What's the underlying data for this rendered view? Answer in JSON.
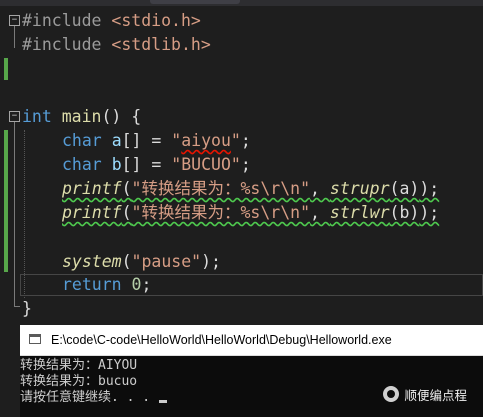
{
  "editor": {
    "lines": {
      "l1": {
        "pre": "#include",
        "arg": "<stdio.h>"
      },
      "l2": {
        "pre": "#include",
        "arg": "<stdlib.h>"
      },
      "l3": {
        "kw": "int",
        "fn": "main",
        "rest": "() {"
      },
      "l4": {
        "kw": "char",
        "var": "a",
        "mid": "[] = ",
        "q1": "\"",
        "str": "aiyou",
        "q2": "\"",
        "end": ";"
      },
      "l5": {
        "kw": "char",
        "var": "b",
        "mid": "[] = ",
        "str": "\"BUCUO\"",
        "end": ";"
      },
      "l6": {
        "fn": "printf",
        "open": "(",
        "str": "\"转换结果为：%s\\r\\n\"",
        "comma": ", ",
        "fn2": "strupr",
        "arg": "(a)",
        "end": ");"
      },
      "l7": {
        "fn": "printf",
        "open": "(",
        "str": "\"转换结果为：%s\\r\\n\"",
        "comma": ", ",
        "fn2": "strlwr",
        "arg": "(b)",
        "end": ");"
      },
      "l8": {
        "fn": "system",
        "open": "(",
        "str": "\"pause\"",
        "end": ");"
      },
      "l9": {
        "kw": "return",
        "num": "0",
        "end": ";"
      },
      "l10": {
        "text": "}"
      }
    },
    "colors": {
      "background": "#1e1e1e",
      "keyword": "#569cd6",
      "string": "#d69d85",
      "function": "#dcdcaa",
      "change_bar": "#57a64a"
    }
  },
  "console": {
    "title": "E:\\code\\C-code\\HelloWorld\\HelloWorld\\Debug\\Helloworld.exe",
    "output": [
      "转换结果为：AIYOU",
      "转换结果为：bucuo",
      "请按任意键继续. . . "
    ],
    "icon": "console-window-icon",
    "watermark": "顺便编点程"
  }
}
